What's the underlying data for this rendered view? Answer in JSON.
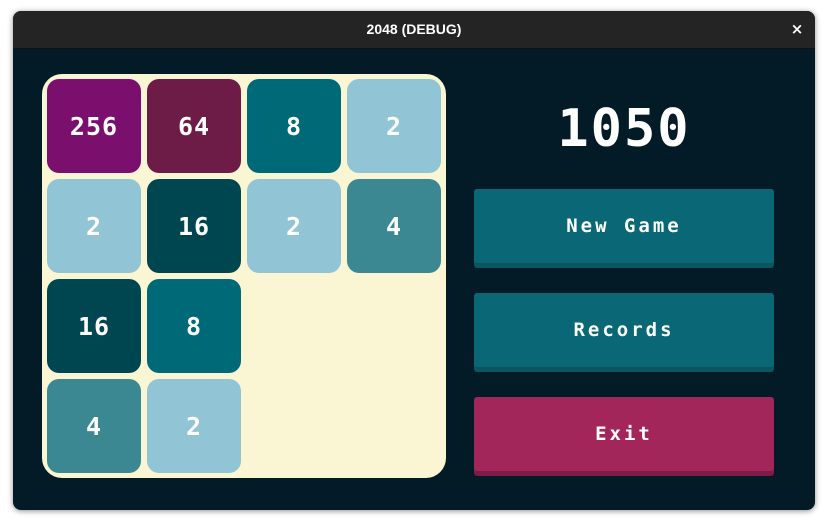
{
  "window": {
    "title": "2048 (DEBUG)",
    "close_glyph": "×"
  },
  "game": {
    "score": "1050",
    "board": [
      [
        {
          "value": "256",
          "color": "#7b0f6e"
        },
        {
          "value": "64",
          "color": "#6c1c47"
        },
        {
          "value": "8",
          "color": "#006977"
        },
        {
          "value": "2",
          "color": "#91c4d5"
        }
      ],
      [
        {
          "value": "2",
          "color": "#91c4d5"
        },
        {
          "value": "16",
          "color": "#004651"
        },
        {
          "value": "2",
          "color": "#91c4d5"
        },
        {
          "value": "4",
          "color": "#3b8893"
        }
      ],
      [
        {
          "value": "16",
          "color": "#004651"
        },
        {
          "value": "8",
          "color": "#006977"
        },
        null,
        null
      ],
      [
        {
          "value": "4",
          "color": "#3b8893"
        },
        {
          "value": "2",
          "color": "#91c4d5"
        },
        null,
        null
      ]
    ]
  },
  "menu": {
    "new_game": "New Game",
    "records": "Records",
    "exit": "Exit"
  },
  "colors": {
    "background": "#031b27",
    "board": "#faf5d3",
    "button": "#0a6775",
    "exit_button": "#a3265b"
  }
}
